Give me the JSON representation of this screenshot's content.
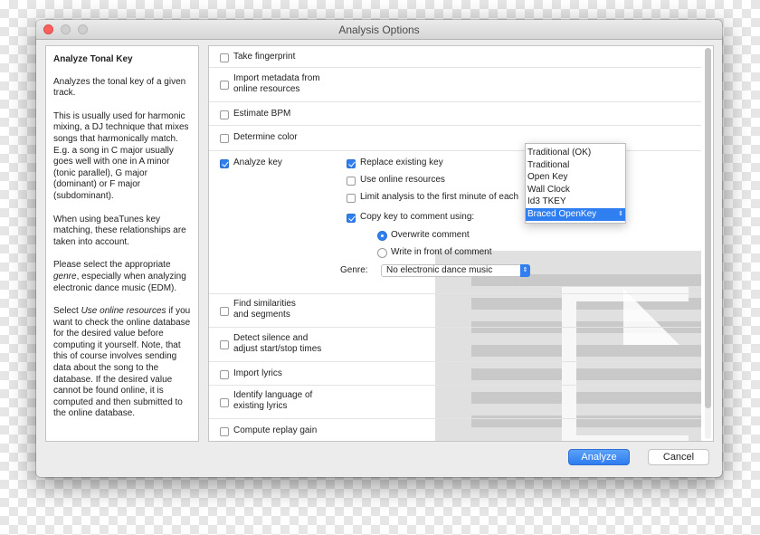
{
  "window": {
    "title": "Analysis Options"
  },
  "help": {
    "title": "Analyze Tonal Key",
    "para1": "Analyzes the tonal key of a given track.",
    "para2": "This is usually used for harmonic mixing, a DJ technique that mixes songs that harmonically match. E.g. a song in C major usually goes well with one in A minor (tonic parallel), G major (dominant) or F major (subdominant).",
    "para3": "When using beaTunes key matching, these relationships are taken into account.",
    "para4_pre": "Please select the appropriate ",
    "para4_em": "genre",
    "para4_post": ", especially when analyzing electronic dance music (EDM).",
    "para5_pre": "Select ",
    "para5_em": "Use online resources",
    "para5_post": " if you want to check the online database for the desired value before computing it yourself. Note, that this of course involves sending data about the song to the database. If the desired value cannot be found online, it is computed and then submitted to the online database."
  },
  "options": {
    "take_fingerprint": {
      "label": "Take fingerprint",
      "checked": false
    },
    "import_metadata": {
      "line1": "Import metadata from",
      "line2": "online resources",
      "checked": false
    },
    "estimate_bpm": {
      "label": "Estimate BPM",
      "checked": false
    },
    "determine_color": {
      "label": "Determine color",
      "checked": false
    },
    "analyze_key": {
      "label": "Analyze key",
      "checked": true,
      "replace_existing": {
        "label": "Replace existing key",
        "checked": true
      },
      "use_online": {
        "label": "Use online resources",
        "checked": false
      },
      "limit_first_minute": {
        "label": "Limit analysis to the first minute of each",
        "checked": false
      },
      "copy_to_comment": {
        "label": "Copy key to comment using:",
        "checked": true
      },
      "overwrite_comment": {
        "label": "Overwrite comment",
        "selected": true
      },
      "write_in_front": {
        "label": "Write in front of comment",
        "selected": false
      },
      "genre_label": "Genre:",
      "genre_value": "No electronic dance music"
    },
    "find_similarities": {
      "line1": "Find similarities",
      "line2": "and segments",
      "checked": false
    },
    "detect_silence": {
      "line1": "Detect silence and",
      "line2": "adjust start/stop times",
      "checked": false
    },
    "import_lyrics": {
      "label": "Import lyrics",
      "checked": false
    },
    "identify_language": {
      "line1": "Identify language of",
      "line2": "existing lyrics",
      "checked": false
    },
    "compute_replay_gain": {
      "label": "Compute replay gain",
      "checked": false
    }
  },
  "key_format_dropdown": {
    "items": [
      "Traditional (OK)",
      "Traditional",
      "Open Key",
      "Wall Clock",
      "Id3 TKEY",
      "Braced OpenKey"
    ],
    "selected": "Braced OpenKey"
  },
  "buttons": {
    "analyze": "Analyze",
    "cancel": "Cancel"
  },
  "colors": {
    "accent": "#2f7ff0",
    "close_light": "#fc605c"
  }
}
